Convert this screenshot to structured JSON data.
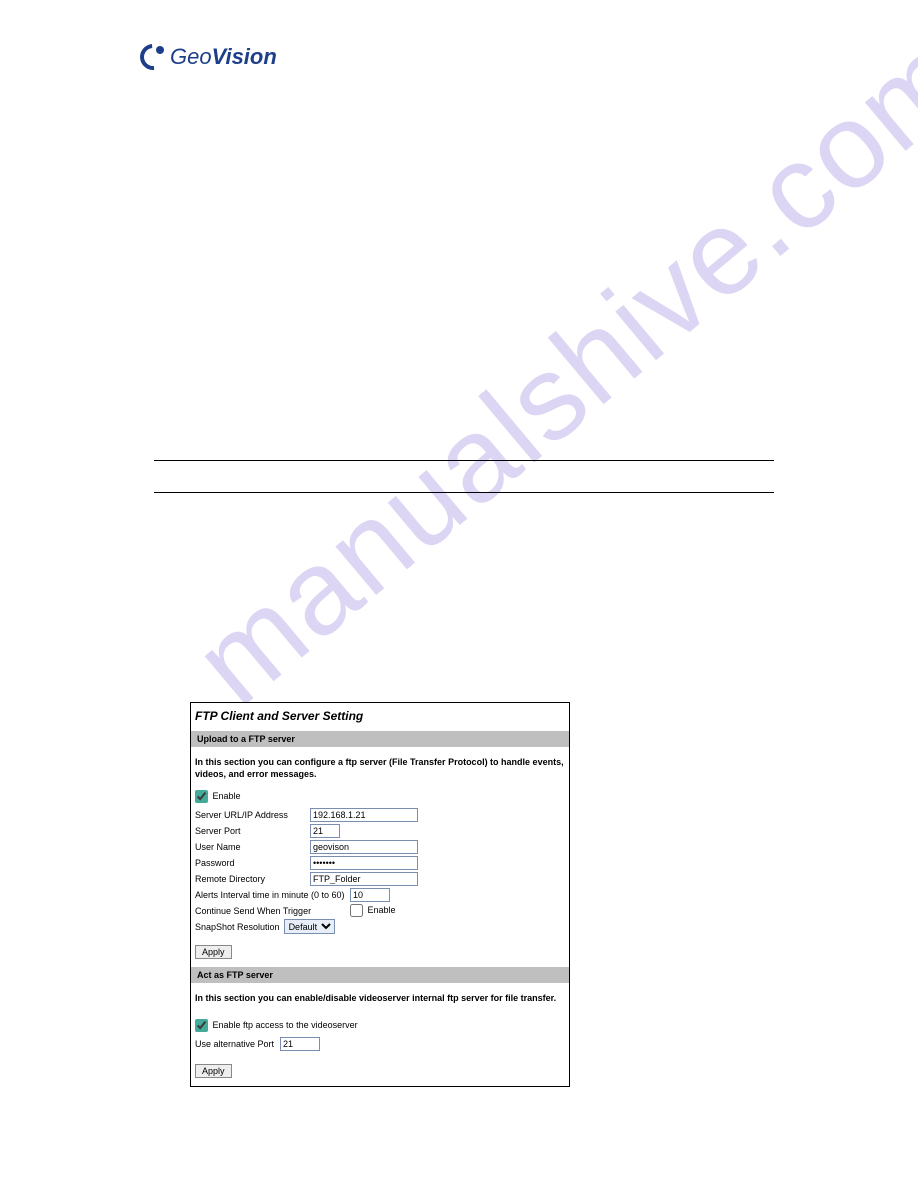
{
  "logo": {
    "brand_geo": "Geo",
    "brand_vision": "Vision"
  },
  "watermark": "manualshive.com",
  "panel": {
    "title": "FTP Client and Server Setting",
    "section1": {
      "header": "Upload to a FTP server",
      "desc": "In this section you can configure a ftp server (File Transfer Protocol) to handle events, videos, and error messages.",
      "enable_label": "Enable",
      "enable_checked": true,
      "fields": {
        "server_url_label": "Server URL/IP Address",
        "server_url_value": "192.168.1.21",
        "server_port_label": "Server Port",
        "server_port_value": "21",
        "user_name_label": "User Name",
        "user_name_value": "geovison",
        "password_label": "Password",
        "password_value": "•••••••",
        "remote_dir_label": "Remote Directory",
        "remote_dir_value": "FTP_Folder",
        "alerts_interval_label": "Alerts Interval time in minute (0 to 60)",
        "alerts_interval_value": "10",
        "continue_send_label": "Continue Send When Trigger",
        "continue_send_enable_label": "Enable",
        "snapshot_res_label": "SnapShot Resolution",
        "snapshot_res_value": "Default"
      },
      "apply_label": "Apply"
    },
    "section2": {
      "header": "Act as FTP server",
      "desc": "In this section you can enable/disable videoserver internal ftp server for file transfer.",
      "enable_ftp_label": "Enable ftp access to the videoserver",
      "enable_ftp_checked": true,
      "alt_port_label": "Use alternative Port",
      "alt_port_value": "21",
      "apply_label": "Apply"
    }
  }
}
